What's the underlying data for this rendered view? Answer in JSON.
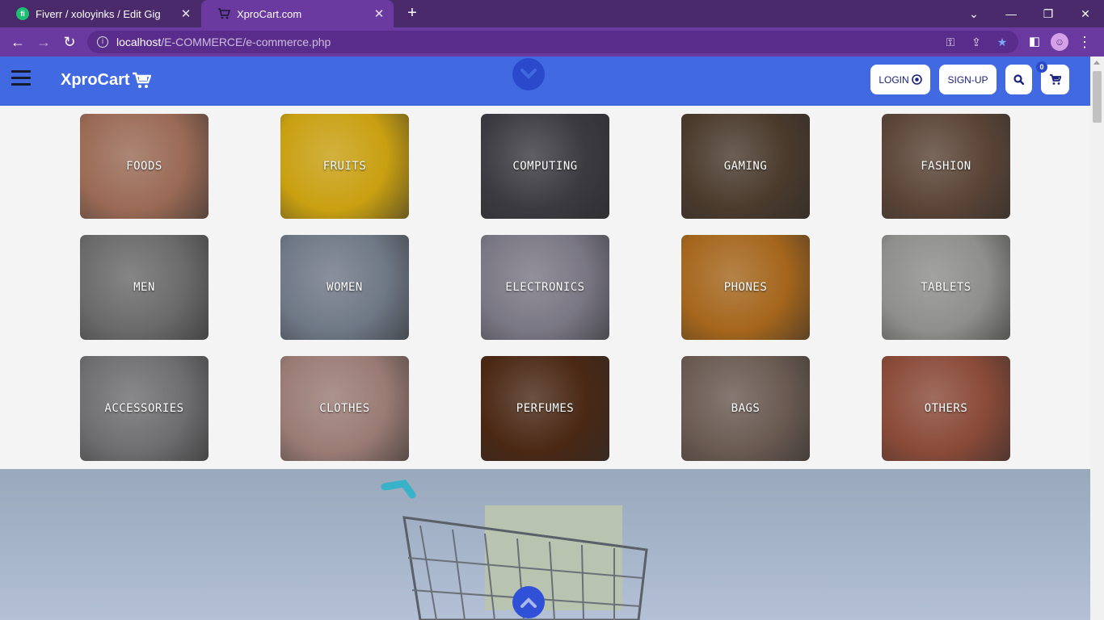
{
  "browser": {
    "tabs": [
      {
        "title": "Fiverr / xoloyinks / Edit Gig",
        "favicon": "fiverr-icon",
        "active": false
      },
      {
        "title": "XproCart.com",
        "favicon": "cart-icon",
        "active": true
      }
    ],
    "address": {
      "host": "localhost",
      "path": "/E-COMMERCE/e-commerce.php"
    }
  },
  "header": {
    "logo": "XproCart",
    "login_label": "LOGIN",
    "signup_label": "SIGN-UP",
    "cart_count": "0",
    "accent_color": "#4169e1"
  },
  "categories": [
    {
      "label": "FOODS",
      "color": "#9a6a55"
    },
    {
      "label": "FRUITS",
      "color": "#c9a011"
    },
    {
      "label": "COMPUTING",
      "color": "#3a3a40"
    },
    {
      "label": "GAMING",
      "color": "#4a3a2c"
    },
    {
      "label": "FASHION",
      "color": "#5a4436"
    },
    {
      "label": "MEN",
      "color": "#6a6a6a"
    },
    {
      "label": "WOMEN",
      "color": "#6f7886"
    },
    {
      "label": "ELECTRONICS",
      "color": "#7a7784"
    },
    {
      "label": "PHONES",
      "color": "#a5661c"
    },
    {
      "label": "TABLETS",
      "color": "#8e8f8c"
    },
    {
      "label": "ACCESSORIES",
      "color": "#6e6e70"
    },
    {
      "label": "CLOTHES",
      "color": "#9a7b74"
    },
    {
      "label": "PERFUMES",
      "color": "#4a2814"
    },
    {
      "label": "BAGS",
      "color": "#6a5a52"
    },
    {
      "label": "OTHERS",
      "color": "#8a4a38"
    }
  ]
}
